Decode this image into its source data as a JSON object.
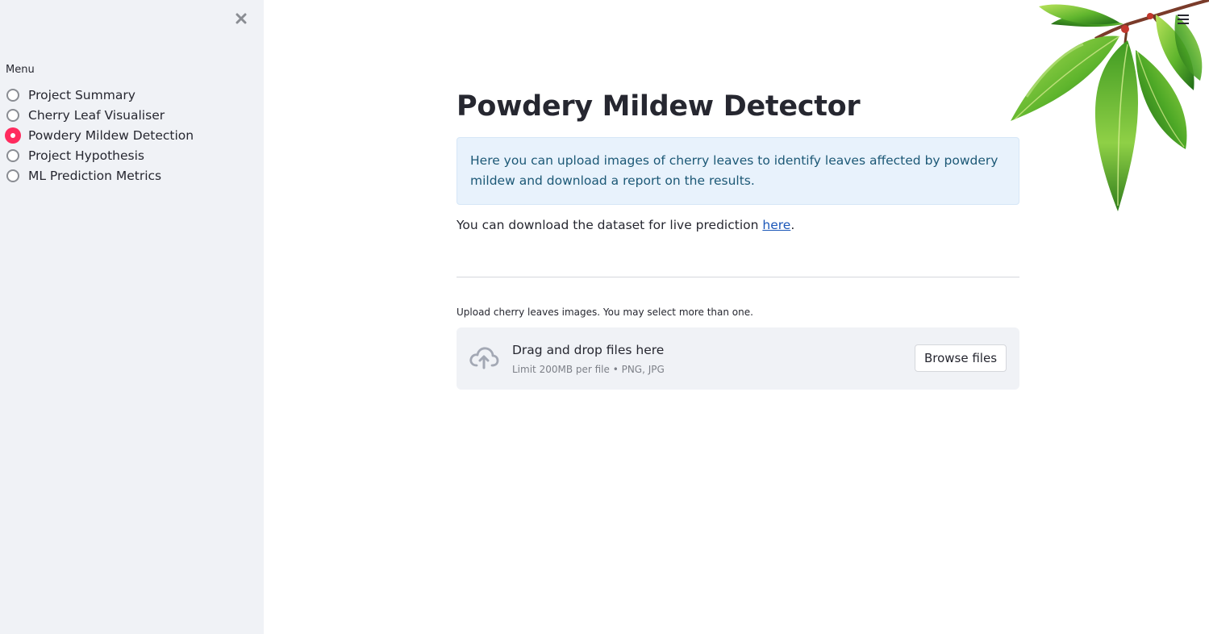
{
  "sidebar": {
    "close_icon": "close-icon",
    "menu_title": "Menu",
    "items": [
      {
        "label": "Project Summary",
        "selected": false
      },
      {
        "label": "Cherry Leaf Visualiser",
        "selected": false
      },
      {
        "label": "Powdery Mildew Detection",
        "selected": true
      },
      {
        "label": "Project Hypothesis",
        "selected": false
      },
      {
        "label": "ML Prediction Metrics",
        "selected": false
      }
    ],
    "accent_color": "#ff2b5e",
    "background_color": "#f0f2f6"
  },
  "header": {
    "menu_icon": "hamburger-menu-icon",
    "decoration": "cherry-leaves-image"
  },
  "main": {
    "title": "Powdery Mildew Detector",
    "info_message": "Here you can upload images of cherry leaves to identify leaves affected by powdery mildew and download a report on the results.",
    "download_text": "You can download the dataset for live prediction ",
    "download_link": "here",
    "download_suffix": ".",
    "uploader": {
      "label": "Upload cherry leaves images. You may select more than one.",
      "icon": "cloud-upload-icon",
      "title": "Drag and drop files here",
      "subtitle": "Limit 200MB per file • PNG, JPG",
      "button_label": "Browse files"
    },
    "info_background_color": "#e8f2fc",
    "info_text_color": "#1c5876",
    "link_color": "#1a56b8"
  }
}
